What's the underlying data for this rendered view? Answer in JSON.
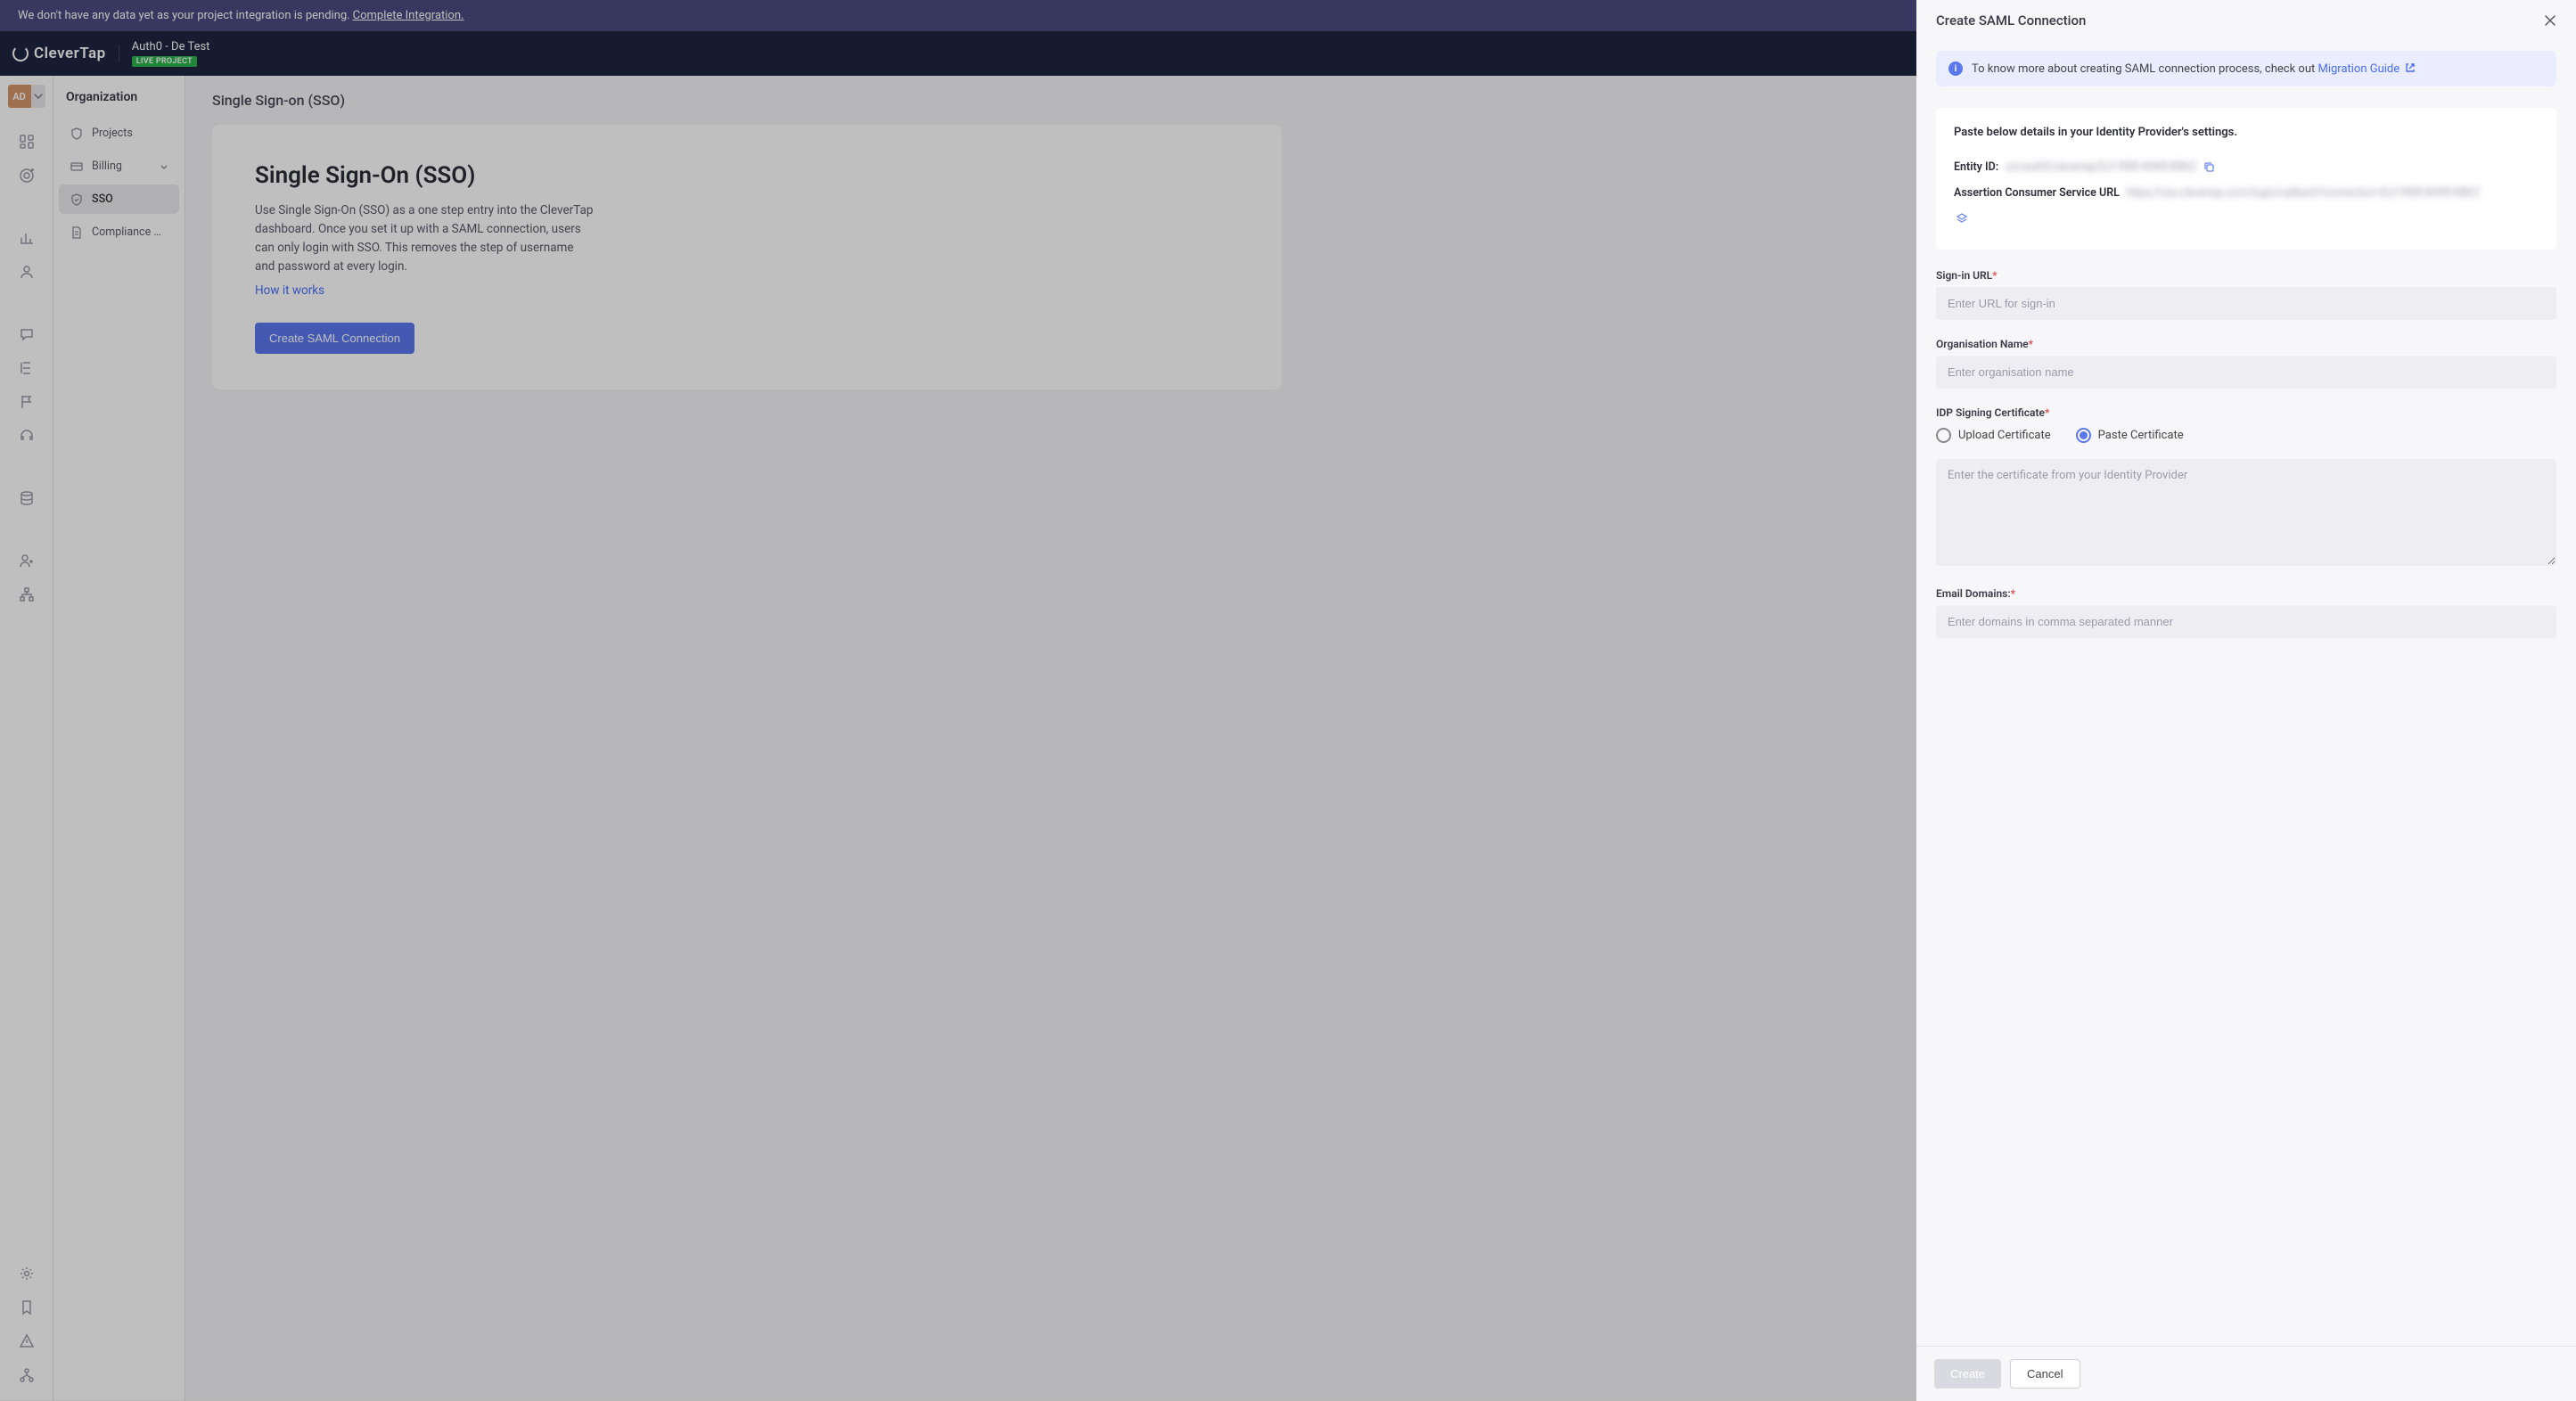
{
  "banner": {
    "message": "We don't have any data yet as your project integration is pending.",
    "link_text": "Complete Integration."
  },
  "header": {
    "logo_text": "CleverTap",
    "project_name": "Auth0 - De Test",
    "project_status": "LIVE PROJECT"
  },
  "avatar_initials": "AD",
  "side_nav": {
    "title": "Organization",
    "items": [
      {
        "label": "Projects",
        "icon": "shield-icon"
      },
      {
        "label": "Billing",
        "icon": "card-icon",
        "expandable": true
      },
      {
        "label": "SSO",
        "icon": "shield-check-icon",
        "active": true
      },
      {
        "label": "Compliance & ...",
        "icon": "doc-icon"
      }
    ]
  },
  "main": {
    "breadcrumb": "Single Sign-on (SSO)",
    "title": "Single Sign-On (SSO)",
    "description": "Use Single Sign-On (SSO) as a one step entry into the CleverTap dashboard. Once you set it up with a SAML connection, users can only login with SSO. This removes the step of username and password at every login.",
    "how_link": "How it works",
    "create_button": "Create SAML Connection"
  },
  "panel": {
    "title": "Create SAML Connection",
    "info_text": "To know more about creating SAML connection process, check out ",
    "info_link": "Migration Guide",
    "idp_card": {
      "title": "Paste below details in your Identity Provider's settings.",
      "entity_label": "Entity ID:",
      "entity_value": "urn:auth0:clevertap:ELF-RRR-WWR-RBKZ",
      "acs_label": "Assertion Consumer Service URL",
      "acs_value": "https://sso.clevertap.com/login/callback?connection=ELF-RRR-WWR-RBKZ"
    },
    "form": {
      "signin_url_label": "Sign-in URL",
      "signin_url_placeholder": "Enter URL for sign-in",
      "org_name_label": "Organisation Name",
      "org_name_placeholder": "Enter organisation name",
      "cert_label": "IDP Signing Certificate",
      "cert_upload_opt": "Upload Certificate",
      "cert_paste_opt": "Paste Certificate",
      "cert_textarea_placeholder": "Enter the certificate from your Identity Provider",
      "domains_label": "Email Domains:",
      "domains_placeholder": "Enter domains in comma separated manner"
    },
    "footer": {
      "create": "Create",
      "cancel": "Cancel"
    }
  }
}
